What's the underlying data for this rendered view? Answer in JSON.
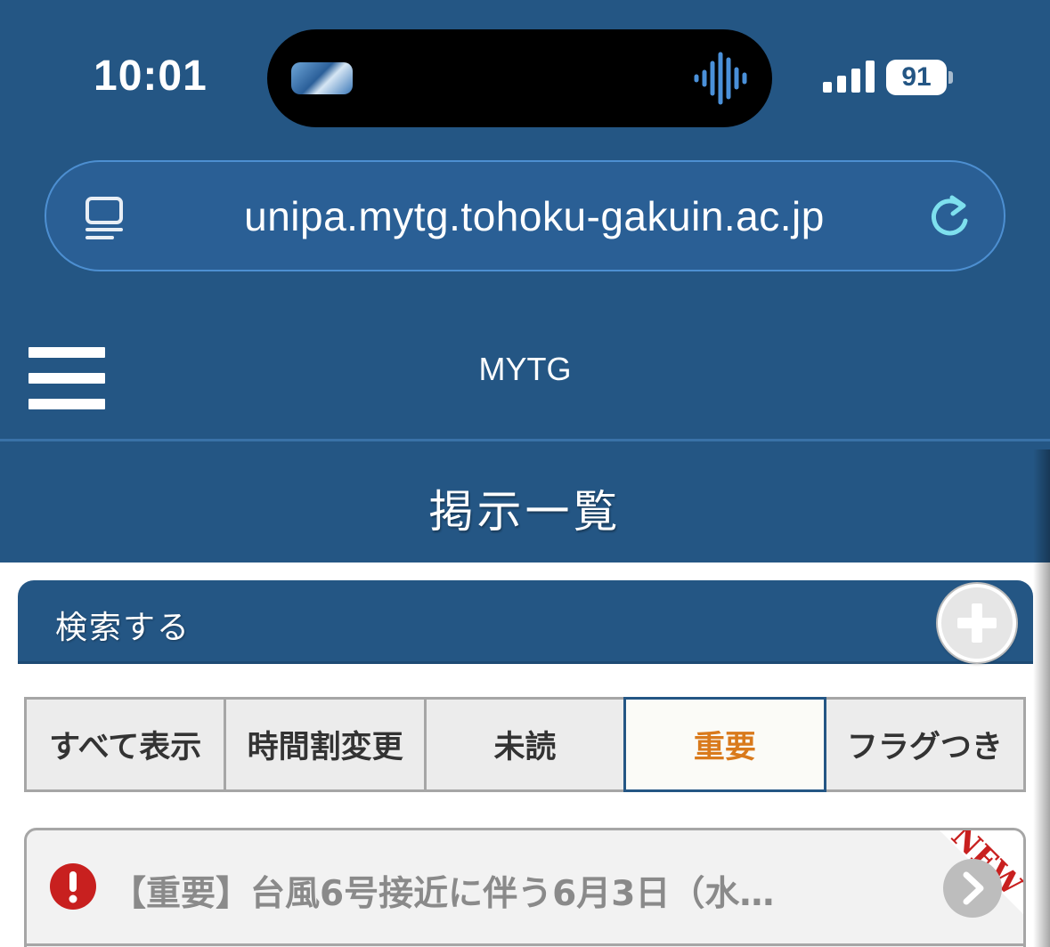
{
  "status_bar": {
    "time": "10:01",
    "battery": "91",
    "icons": [
      "island-thumbnail",
      "audio-wave-icon",
      "signal-bars-icon",
      "battery-icon"
    ]
  },
  "browser": {
    "url": "unipa.mytg.tohoku-gakuin.ac.jp",
    "icons": [
      "reader-mode-icon",
      "reload-icon"
    ]
  },
  "header": {
    "app_title": "MYTG",
    "page_title": "掲示一覧",
    "menu_icon": "hamburger-menu-icon"
  },
  "search": {
    "label": "検索する",
    "toggle_icon": "plus-icon"
  },
  "tabs": [
    {
      "label": "すべて表示",
      "active": false
    },
    {
      "label": "時間割変更",
      "active": false
    },
    {
      "label": "未読",
      "active": false
    },
    {
      "label": "重要",
      "active": true
    },
    {
      "label": "フラグつき",
      "active": false
    }
  ],
  "notices": [
    {
      "title": "【重要】台風6号接近に伴う6月3日（水…",
      "badge": "NEW",
      "icons": [
        "exclamation-icon",
        "chevron-right-icon"
      ]
    }
  ],
  "colors": {
    "header_bg": "#245684",
    "active_tab_text": "#d97a1c",
    "alert_red": "#c8201f",
    "new_badge_red": "#c8201f"
  }
}
